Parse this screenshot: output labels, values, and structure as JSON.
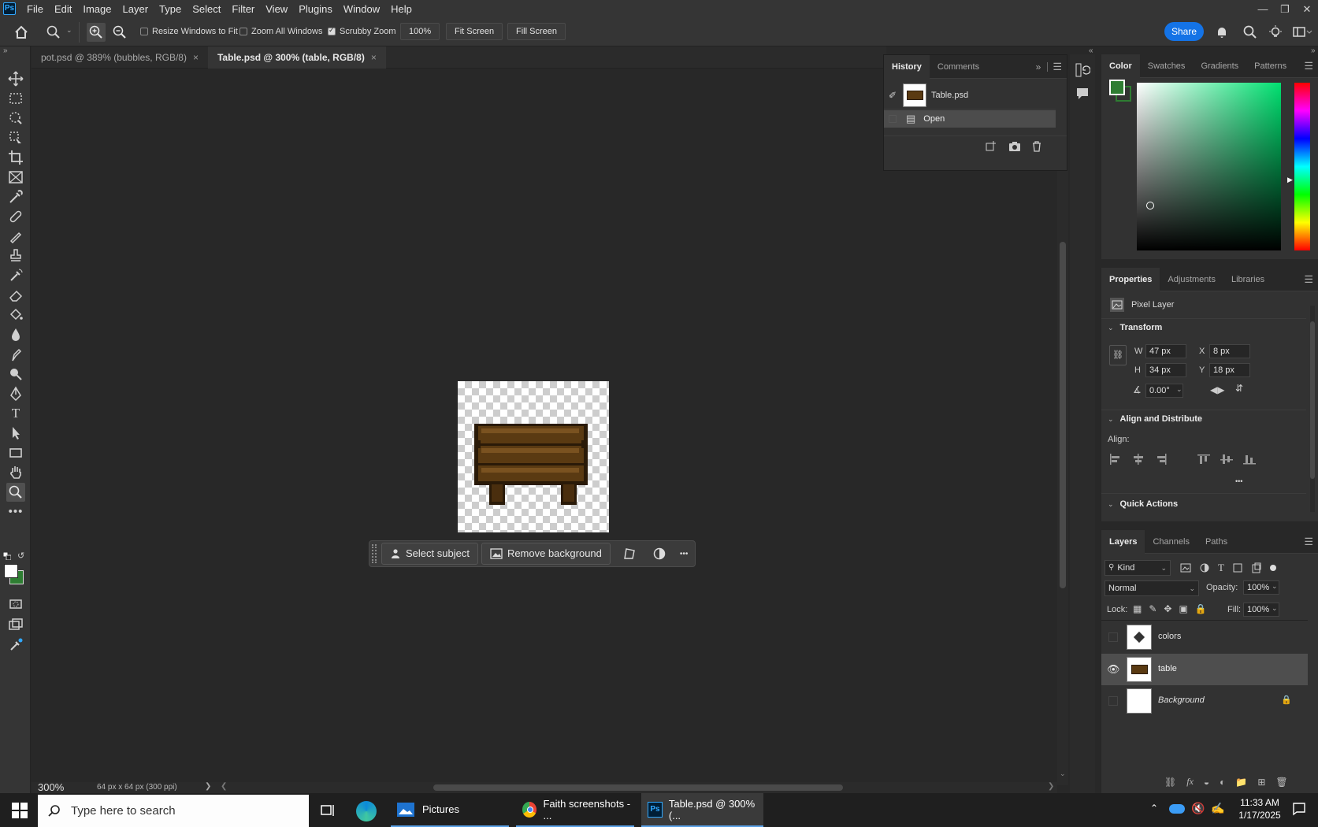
{
  "app": {
    "logo": "Ps",
    "name": "Adobe Photoshop"
  },
  "menu": [
    "File",
    "Edit",
    "Image",
    "Layer",
    "Type",
    "Select",
    "Filter",
    "View",
    "Plugins",
    "Window",
    "Help"
  ],
  "options": {
    "resize_windows_to_fit": "Resize Windows to Fit",
    "zoom_all_windows": "Zoom All Windows",
    "scrubby_zoom": "Scrubby Zoom",
    "zoom_value": "100%",
    "fit_screen": "Fit Screen",
    "fill_screen": "Fill Screen",
    "share": "Share"
  },
  "tabs": [
    {
      "label": "pot.psd @ 389% (bubbles, RGB/8)",
      "close": "×"
    },
    {
      "label": "Table.psd @ 300% (table, RGB/8)",
      "close": "×"
    }
  ],
  "status": {
    "zoom": "300%",
    "doc_info": "64 px x 64 px (300 ppi)",
    "arrow": "❯"
  },
  "context_bar": {
    "select_subject": "Select subject",
    "remove_background": "Remove background",
    "more": "•••"
  },
  "history": {
    "tabs": [
      "History",
      "Comments"
    ],
    "snapshot": "Table.psd",
    "steps": [
      "Open"
    ]
  },
  "color_panel": {
    "tabs": [
      "Color",
      "Swatches",
      "Gradients",
      "Patterns"
    ],
    "foreground": "#ffffff",
    "background": "#2e7d32"
  },
  "properties": {
    "tabs": [
      "Properties",
      "Adjustments",
      "Libraries"
    ],
    "kind": "Pixel Layer",
    "transform_title": "Transform",
    "w_label": "W",
    "w": "47 px",
    "h_label": "H",
    "h": "34 px",
    "x_label": "X",
    "x": "8 px",
    "y_label": "Y",
    "y": "18 px",
    "angle": "0.00°",
    "align_title": "Align and Distribute",
    "align_label": "Align:",
    "quick_actions": "Quick Actions",
    "more": "•••"
  },
  "layers": {
    "tabs": [
      "Layers",
      "Channels",
      "Paths"
    ],
    "filter": "Kind",
    "blend_mode": "Normal",
    "opacity_label": "Opacity:",
    "opacity": "100%",
    "lock_label": "Lock:",
    "fill_label": "Fill:",
    "fill": "100%",
    "items": [
      {
        "name": "colors",
        "visible": false
      },
      {
        "name": "table",
        "visible": true,
        "selected": true
      },
      {
        "name": "Background",
        "visible": false,
        "locked": true
      }
    ]
  },
  "taskbar": {
    "search_placeholder": "Type here to search",
    "apps": [
      {
        "label": "Pictures"
      },
      {
        "label": "Faith screenshots - ..."
      },
      {
        "label": "Table.psd @ 300% (..."
      }
    ],
    "time": "11:33 AM",
    "date": "1/17/2025"
  }
}
